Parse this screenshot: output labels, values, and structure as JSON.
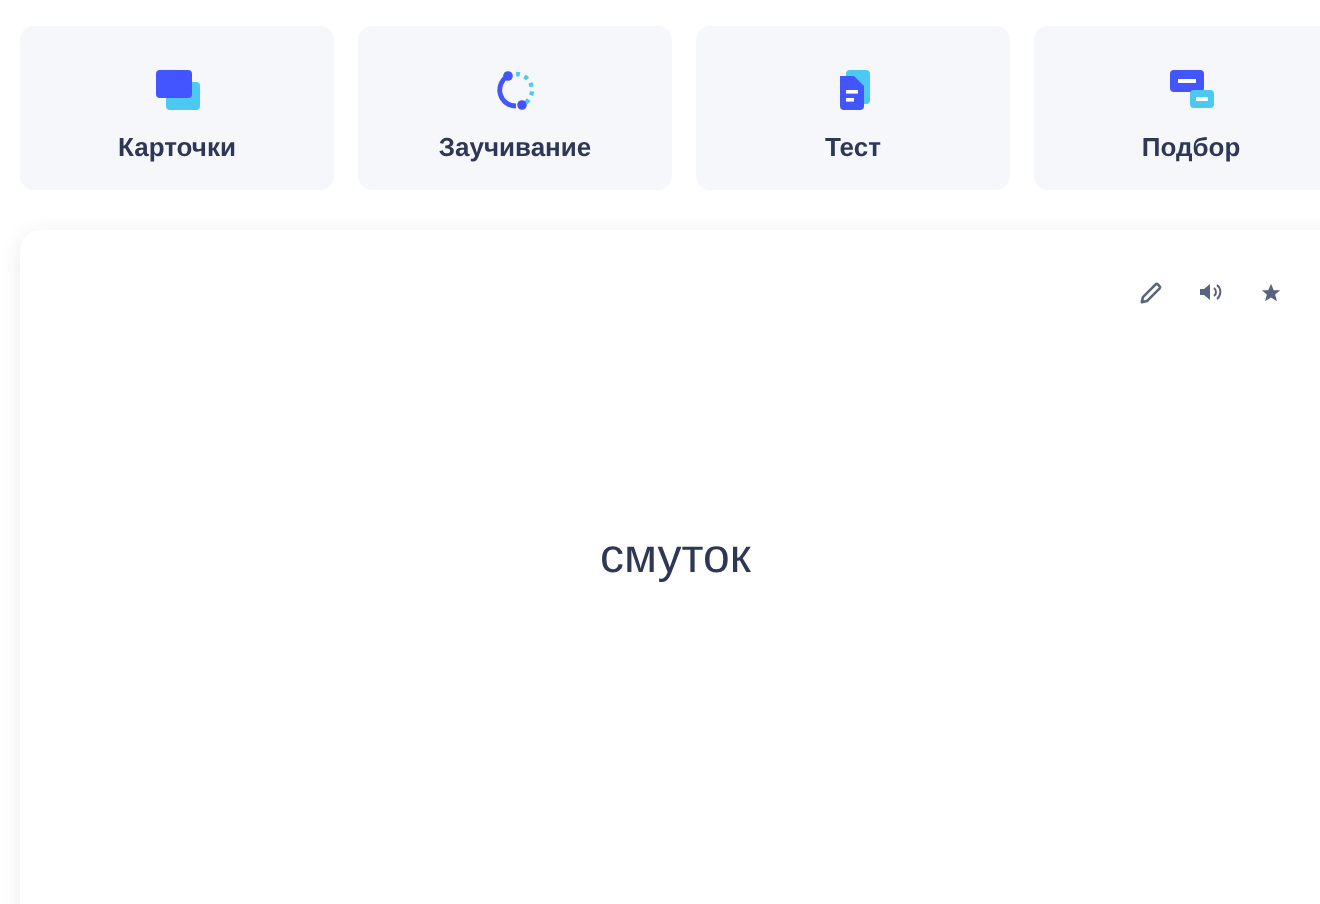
{
  "modes": [
    {
      "label": "Карточки",
      "kind": "cards"
    },
    {
      "label": "Заучивание",
      "kind": "learn"
    },
    {
      "label": "Тест",
      "kind": "test"
    },
    {
      "label": "Подбор",
      "kind": "match"
    }
  ],
  "card": {
    "term": "смуток"
  }
}
